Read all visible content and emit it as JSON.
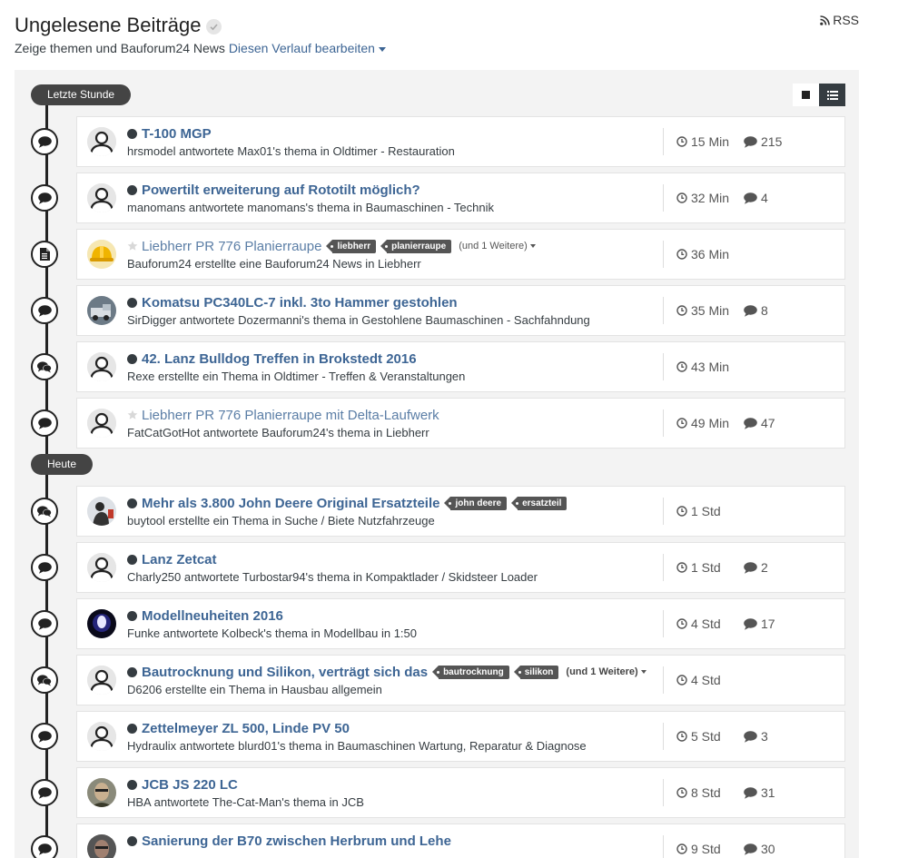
{
  "header": {
    "title": "Ungelesene Beiträge",
    "subtitle": "Zeige themen und Bauforum24 News",
    "edit_link": "Diesen Verlauf bearbeiten",
    "rss_label": "RSS"
  },
  "sections": [
    {
      "label": "Letzte Stunde",
      "items": [
        {
          "marker": "comment-icon",
          "avatar": "default",
          "unread": true,
          "title": "T-100 MGP",
          "tags": [],
          "more": "",
          "snippet": "hrsmodel antwortete Max01's thema in Oldtimer - Restauration",
          "time": "15 Min",
          "replies": "215"
        },
        {
          "marker": "comment-icon",
          "avatar": "default",
          "unread": true,
          "title": "Powertilt erweiterung auf Rototilt möglich?",
          "tags": [],
          "more": "",
          "snippet": "manomans antwortete manomans's thema in Baumaschinen - Technik",
          "time": "32 Min",
          "replies": "4"
        },
        {
          "marker": "document-icon",
          "avatar": "helmet",
          "unread": false,
          "title": "Liebherr PR 776 Planierraupe",
          "tags": [
            "liebherr",
            "planierraupe"
          ],
          "more": "(und 1 Weitere)",
          "snippet": "Bauforum24 erstellte eine Bauforum24 News in Liebherr",
          "time": "36 Min",
          "replies": ""
        },
        {
          "marker": "comment-icon",
          "avatar": "photo-truck",
          "unread": true,
          "title": "Komatsu PC340LC-7 inkl. 3to Hammer gestohlen",
          "tags": [],
          "more": "",
          "snippet": "SirDigger antwortete Dozermanni's thema in Gestohlene Baumaschinen - Sachfahndung",
          "time": "35 Min",
          "replies": "8"
        },
        {
          "marker": "comments-icon",
          "avatar": "default",
          "unread": true,
          "title": "42. Lanz Bulldog Treffen in Brokstedt 2016",
          "tags": [],
          "more": "",
          "snippet": "Rexe erstellte ein Thema in Oldtimer - Treffen & Veranstaltungen",
          "time": "43 Min",
          "replies": ""
        },
        {
          "marker": "comment-icon",
          "avatar": "default",
          "unread": false,
          "title": "Liebherr PR 776 Planierraupe mit Delta-Laufwerk",
          "tags": [],
          "more": "",
          "snippet": "FatCatGotHot antwortete Bauforum24's thema in Liebherr",
          "time": "49 Min",
          "replies": "47"
        }
      ]
    },
    {
      "label": "Heute",
      "items": [
        {
          "marker": "comments-icon",
          "avatar": "photo-figure",
          "unread": true,
          "title": "Mehr als 3.800 John Deere Original Ersatzteile",
          "tags": [
            "john deere",
            "ersatzteil"
          ],
          "more": "",
          "snippet": "buytool erstellte ein Thema in Suche / Biete Nutzfahrzeuge",
          "time": "1 Std",
          "replies": ""
        },
        {
          "marker": "comment-icon",
          "avatar": "default",
          "unread": true,
          "title": "Lanz Zetcat",
          "tags": [],
          "more": "",
          "snippet": "Charly250 antwortete Turbostar94's thema in Kompaktlader / Skidsteer Loader",
          "time": "1 Std",
          "replies": "2"
        },
        {
          "marker": "comment-icon",
          "avatar": "photo-helmet",
          "unread": true,
          "title": "Modellneuheiten 2016",
          "tags": [],
          "more": "",
          "snippet": "Funke antwortete Kolbeck's thema in Modellbau in 1:50",
          "time": "4 Std",
          "replies": "17"
        },
        {
          "marker": "comments-icon",
          "avatar": "default",
          "unread": true,
          "title": "Bautrocknung und Silikon, verträgt sich das",
          "tags": [
            "bautrocknung",
            "silikon"
          ],
          "more": "(und 1 Weitere)",
          "snippet": "D6206 erstellte ein Thema in Hausbau allgemein",
          "time": "4 Std",
          "replies": ""
        },
        {
          "marker": "comment-icon",
          "avatar": "default",
          "unread": true,
          "title": "Zettelmeyer ZL 500, Linde PV 50",
          "tags": [],
          "more": "",
          "snippet": "Hydraulix antwortete blurd01's thema in Baumaschinen Wartung, Reparatur & Diagnose",
          "time": "5 Std",
          "replies": "3"
        },
        {
          "marker": "comment-icon",
          "avatar": "photo-face",
          "unread": true,
          "title": "JCB JS 220 LC",
          "tags": [],
          "more": "",
          "snippet": "HBA antwortete The-Cat-Man's thema in JCB",
          "time": "8 Std",
          "replies": "31"
        },
        {
          "marker": "comment-icon",
          "avatar": "photo-face2",
          "unread": true,
          "title": "Sanierung der B70 zwischen Herbrum und Lehe",
          "tags": [],
          "more": "",
          "snippet": "",
          "time": "9 Std",
          "replies": "30"
        }
      ]
    }
  ],
  "colors": {
    "link": "#3d6594",
    "read_link": "#5b7ea6",
    "dark": "#353c41",
    "background": "#f3f3f3"
  }
}
